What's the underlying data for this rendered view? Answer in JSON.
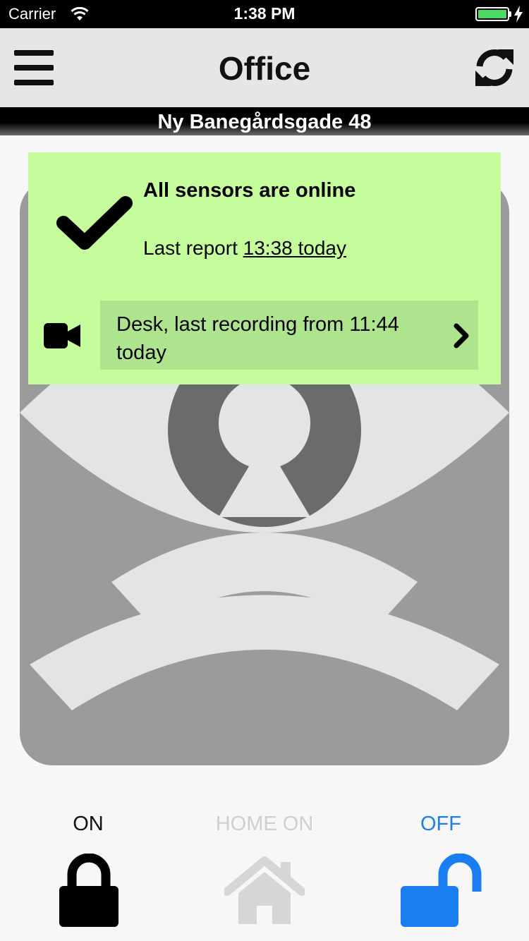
{
  "status_bar": {
    "carrier": "Carrier",
    "time": "1:38 PM",
    "battery_color": "#4cd964"
  },
  "nav": {
    "title": "Office",
    "menu_icon": "hamburger-menu-icon",
    "refresh_icon": "refresh-icon"
  },
  "address": "Ny Banegårdsgade 48",
  "status_card": {
    "background": "#c5fd9d",
    "icon": "checkmark-icon",
    "headline": "All sensors are online",
    "report_prefix": "Last report ",
    "report_time": "13:38 today",
    "recording": {
      "icon": "video-camera-icon",
      "text": "Desk, last recording from 11:44 today",
      "background": "#aee48e"
    }
  },
  "modes": [
    {
      "label": "ON",
      "icon": "lock-closed-icon",
      "color": "#111111"
    },
    {
      "label": "HOME ON",
      "icon": "home-icon",
      "color": "#cfcfcf"
    },
    {
      "label": "OFF",
      "icon": "lock-open-icon",
      "color": "#1a7ef0",
      "selected": true
    }
  ]
}
